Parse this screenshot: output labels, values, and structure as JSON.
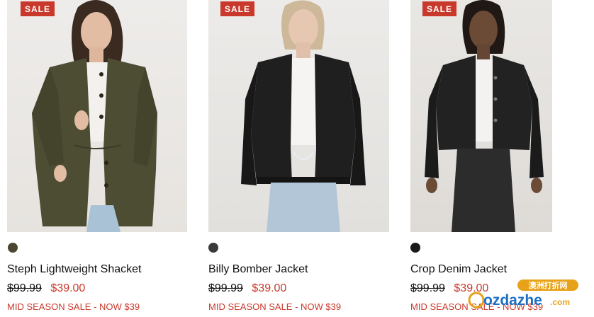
{
  "products": [
    {
      "badge": "SALE",
      "name": "Steph Lightweight Shacket",
      "was_price": "$99.99",
      "now_price": "$39.00",
      "promo": "MID SEASON SALE - NOW $39",
      "swatch_color": "#4a4630",
      "garment_color": "#4d4d34"
    },
    {
      "badge": "SALE",
      "name": "Billy Bomber Jacket",
      "was_price": "$99.99",
      "now_price": "$39.00",
      "promo": "MID SEASON SALE - NOW $39",
      "swatch_color": "#3a3a3a",
      "garment_color": "#1f1f1f"
    },
    {
      "badge": "SALE",
      "name": "Crop Denim Jacket",
      "was_price": "$99.99",
      "now_price": "$39.00",
      "promo": "MID SEASON SALE - NOW $39",
      "swatch_color": "#1a1a1a",
      "garment_color": "#222222"
    }
  ],
  "watermark": {
    "top_text": "澳洲打折网",
    "brand": "ozdazhe",
    "suffix": ".com"
  },
  "colors": {
    "sale_red": "#c8392b",
    "text": "#111111"
  }
}
